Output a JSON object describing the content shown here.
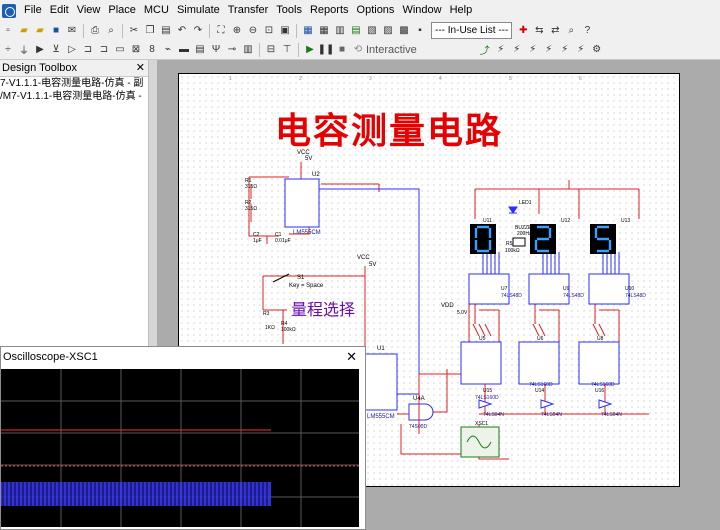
{
  "menu": [
    "File",
    "Edit",
    "View",
    "Place",
    "MCU",
    "Simulate",
    "Transfer",
    "Tools",
    "Reports",
    "Options",
    "Window",
    "Help"
  ],
  "toolbar": {
    "in_use_list": "--- In-Use List ---",
    "interactive_label": "Interactive"
  },
  "design_toolbox": {
    "title": "Design Toolbox",
    "items": [
      "7-V1.1.1-电容测量电路-仿真 - 副",
      "/M7-V1.1.1-电容测量电路-仿真 -"
    ]
  },
  "schematic": {
    "title": "电容测量电路",
    "range_label": "量程选择",
    "digits": [
      "0",
      "2",
      "5"
    ],
    "labels": {
      "vcc1": "VCC",
      "v5a": "5V",
      "u2": "U2",
      "r1": "R1",
      "r1v": "315Ω",
      "r2": "R2",
      "r2v": "315Ω",
      "c2": "C2",
      "c2v": "1μF",
      "c1": "C1",
      "c1v": "0.01μF",
      "lm555_a": "LM555CM",
      "s1": "S1",
      "key": "Key = Space",
      "vcc2": "VCC",
      "v5b": "5V",
      "r3": "R3",
      "r3v": "1KΩ",
      "r4": "R4",
      "r4v": "100kΩ",
      "r5": "R5",
      "r5v": "100kΩ",
      "u1": "U1",
      "lm555_b": "LM555CM",
      "u4a": "U4A",
      "u4apart": "74S00D",
      "vdd": "VDD",
      "v50": "5.0V",
      "led1": "LED1",
      "buzzer": "BUZZER",
      "buzzer_f": "200Hz",
      "u11": "U11",
      "u12": "U12",
      "u13": "U13",
      "u7": "U7",
      "u7p": "74LS48D",
      "u9": "U9",
      "u9p": "74LS48D",
      "u10": "U10",
      "u10p": "74LS48D",
      "u5": "U5",
      "u6": "U6",
      "u8": "U8",
      "u15": "U15",
      "u15p": "74LS160D",
      "u14": "U14",
      "u14p": "74LS160D",
      "u16": "U16",
      "u16p": "74LS160D",
      "lw1": "74LS04N",
      "lw2": "74LS04N",
      "lw3": "74LS04N",
      "xsc1": "XSC1",
      "r5lab": "R5"
    }
  },
  "oscilloscope": {
    "title": "Oscilloscope-XSC1"
  },
  "colors": {
    "wire_red": "#e02020",
    "wire_blue": "#2d2dff",
    "trace_red": "#ff3030",
    "trace_blue": "#3a3aff",
    "title_red": "#e60000"
  }
}
